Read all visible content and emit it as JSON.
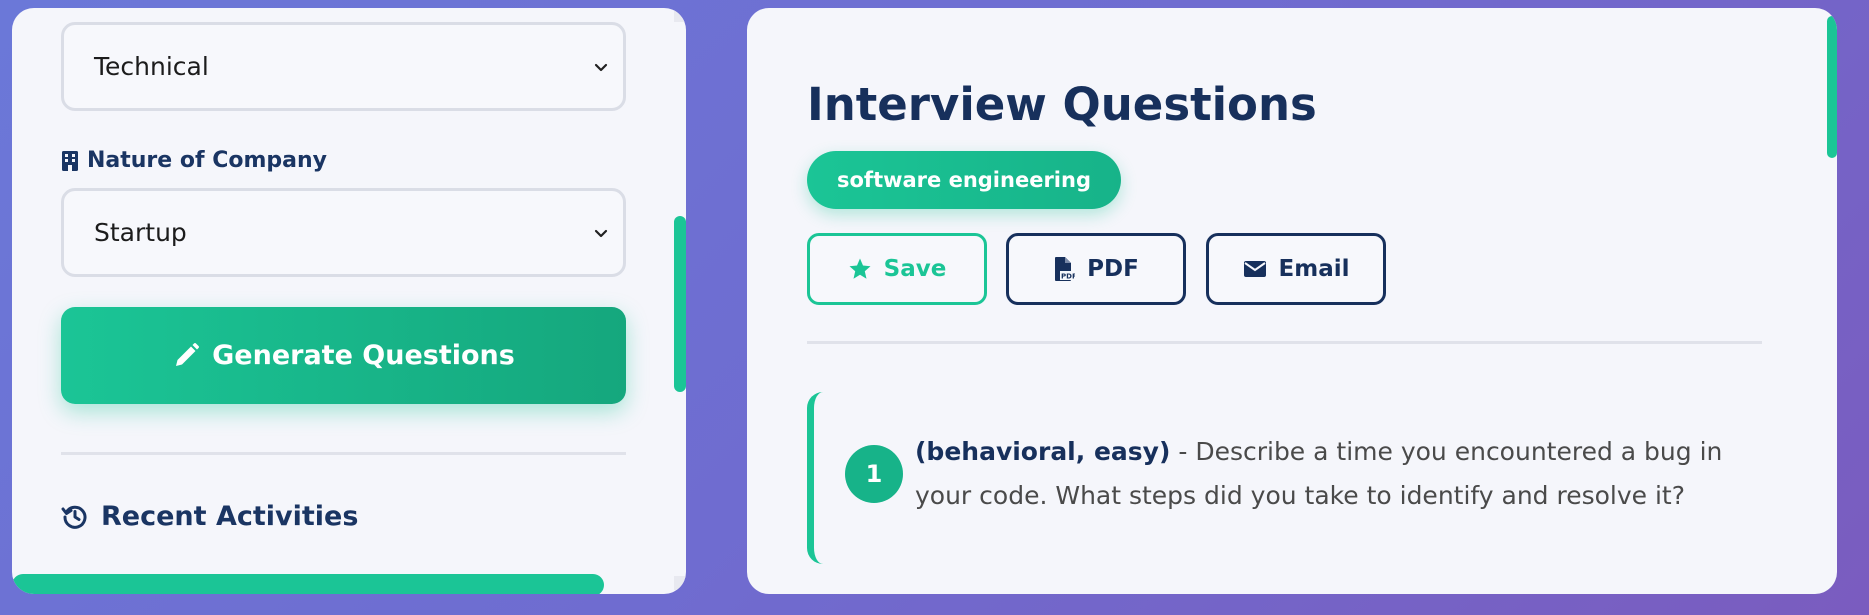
{
  "form": {
    "type_select": {
      "value": "Technical"
    },
    "company_label": "Nature of Company",
    "company_select": {
      "value": "Startup"
    },
    "generate_label": "Generate Questions",
    "recent_title": "Recent Activities"
  },
  "results": {
    "title": "Interview Questions",
    "tag": "software engineering",
    "actions": {
      "save": "Save",
      "pdf": "PDF",
      "email": "Email"
    },
    "questions": [
      {
        "number": "1",
        "meta": "(behavioral, easy)",
        "separator": " - ",
        "text": "Describe a time you encountered a bug in your code. What steps did you take to identify and resolve it?"
      }
    ]
  },
  "colors": {
    "accent": "#1bc596",
    "navy": "#17305c",
    "background_start": "#6b78d8",
    "background_end": "#7a5cbf"
  },
  "icons": {
    "company": "building-icon",
    "generate": "pencil-icon",
    "recent": "history-icon",
    "save": "star-icon",
    "pdf": "file-pdf-icon",
    "email": "envelope-icon",
    "select": "chevron-down-icon"
  }
}
